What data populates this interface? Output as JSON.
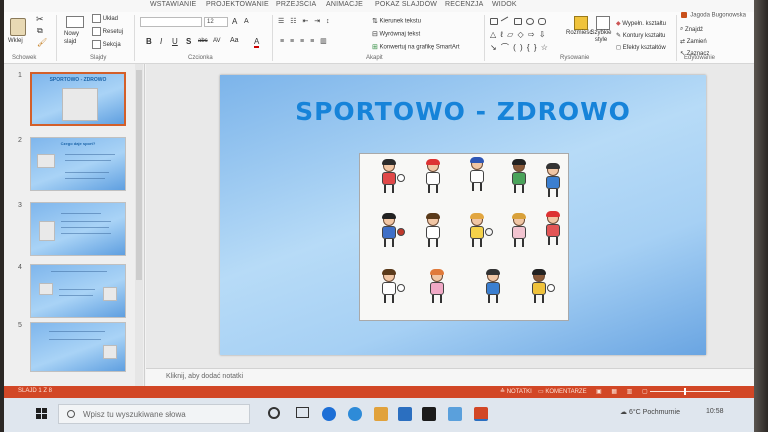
{
  "ribbon_tabs": [
    "WSTAWIANIE",
    "PROJEKTOWANIE",
    "PRZEJŚCIA",
    "ANIMACJE",
    "POKAZ SLAJDÓW",
    "RECENZJA",
    "WIDOK"
  ],
  "account": {
    "name": "Jagoda Bugonowska"
  },
  "ribbon": {
    "clipboard": {
      "paste_label": "Wklej",
      "group_label": "Schowek"
    },
    "slides": {
      "new_slide_label": "Nowy slajd",
      "layout_label": "Układ",
      "reset_label": "Resetuj",
      "section_label": "Sekcja",
      "group_label": "Slajdy"
    },
    "font": {
      "font_size": "12",
      "group_label": "Czcionka",
      "bold": "B",
      "italic": "I",
      "underline": "U",
      "shadow": "S",
      "strike": "abc",
      "spacing": "AV",
      "case": "Aa",
      "color": "A",
      "grow": "A",
      "shrink": "A"
    },
    "paragraph": {
      "text_direction_label": "Kierunek tekstu",
      "align_text_label": "Wyrównaj tekst",
      "smartart_label": "Konwertuj na grafikę SmartArt",
      "group_label": "Akapit"
    },
    "drawing": {
      "arrange_label": "Rozmieść",
      "quick_styles_label": "Szybkie style",
      "fill_label": "Wypełn. kształtu",
      "outline_label": "Kontury kształtu",
      "effects_label": "Efekty kształtów",
      "group_label": "Rysowanie"
    },
    "editing": {
      "find_label": "Znajdź",
      "replace_label": "Zamień",
      "select_label": "Zaznacz",
      "group_label": "Edytowanie"
    }
  },
  "thumbnails": [
    {
      "number": "1",
      "title": "SPORTOWO - ZDROWO",
      "selected": true
    },
    {
      "number": "2",
      "title": "Czego daje sport?",
      "selected": false
    },
    {
      "number": "3",
      "title": "",
      "selected": false
    },
    {
      "number": "4",
      "title": "",
      "selected": false
    },
    {
      "number": "5",
      "title": "",
      "selected": false
    }
  ],
  "slide": {
    "title": "SPORTOWO - ZDROWO"
  },
  "notes_placeholder": "Kliknij, aby dodać notatki",
  "status": {
    "slide_counter": "SLAJD 1 Z 8",
    "notes_button": "NOTATKI",
    "comments_button": "KOMENTARZE"
  },
  "taskbar": {
    "search_placeholder": "Wpisz tu wyszukiwane słowa",
    "weather": "6°C Pochmurnie",
    "time": "10:58"
  },
  "colors": {
    "accent": "#d24726",
    "title_blue": "#1683d9"
  }
}
